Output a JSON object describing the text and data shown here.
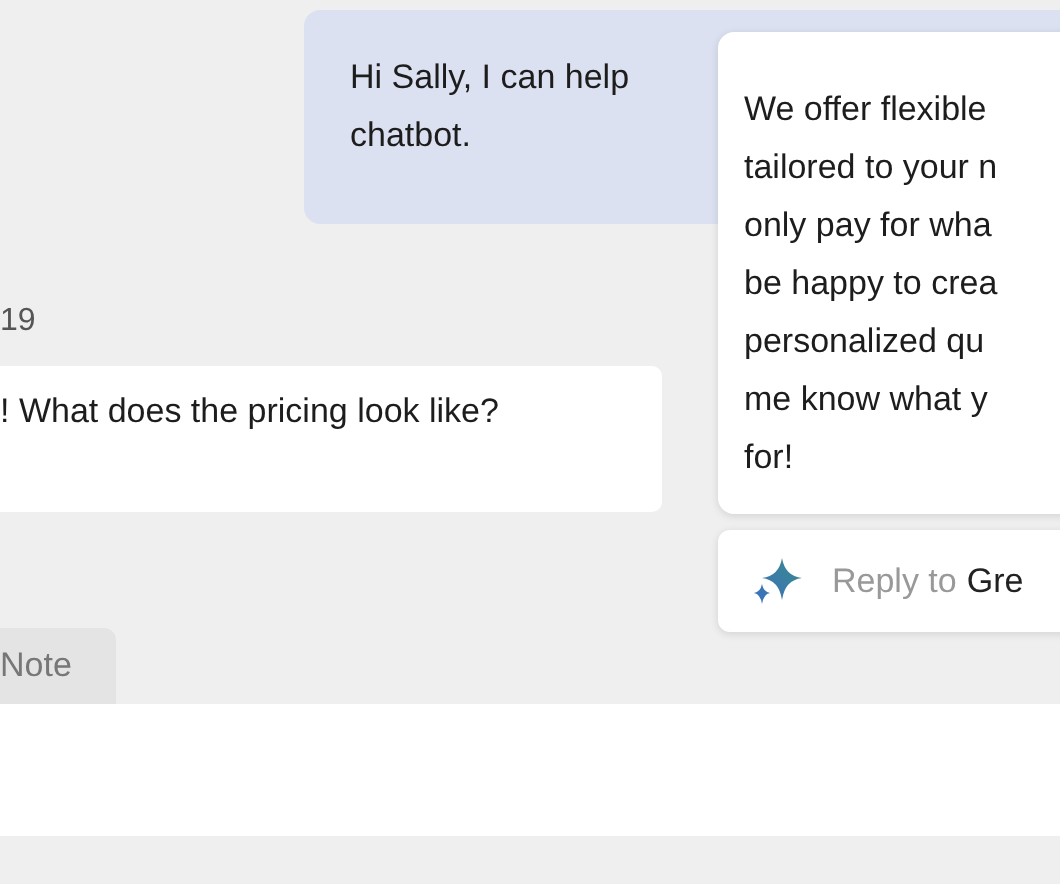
{
  "agent_message": {
    "lines": [
      "Hi Sally, I can help",
      "chatbot."
    ]
  },
  "timestamp": "19",
  "customer_message": {
    "text": "! What does the pricing look like?"
  },
  "composer": {
    "tabs": [
      {
        "label": "Note",
        "selected": false
      }
    ]
  },
  "suggestion": {
    "lines": [
      "We offer flexible",
      "tailored to your n",
      "only pay for wha",
      "be happy to crea",
      "personalized qu",
      "me know what y",
      "for!"
    ]
  },
  "reply_chip": {
    "prefix": "Reply to",
    "name": "Gre"
  }
}
